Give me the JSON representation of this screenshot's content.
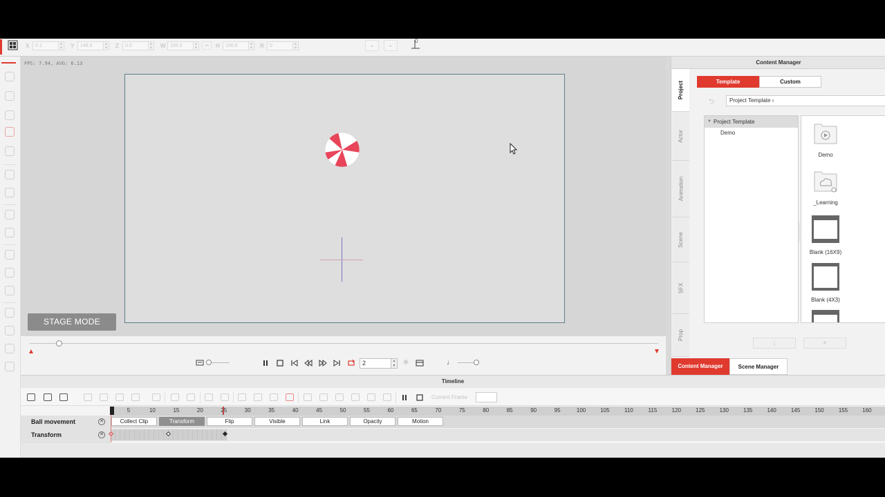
{
  "transform": {
    "fields": [
      {
        "label": "X",
        "value": "0.1"
      },
      {
        "label": "Y",
        "value": "149.9"
      },
      {
        "label": "Z",
        "value": "0.0"
      },
      {
        "label": "W",
        "value": "100.0"
      },
      {
        "label": "H",
        "value": "100.0"
      },
      {
        "label": "R",
        "value": "0"
      }
    ],
    "anchor_value": "0"
  },
  "stage": {
    "fps_text": "FPS: 7.94, AVG: 6.13",
    "mode_button": "STAGE MODE"
  },
  "playback": {
    "frame_value": "2"
  },
  "content_manager": {
    "title": "Content Manager",
    "vertical_tabs": [
      "Project",
      "Actor",
      "Animation",
      "Scene",
      "SFX",
      "Prop"
    ],
    "active_tab": "Project",
    "segment_tabs": [
      "Template",
      "Custom"
    ],
    "active_segment": "Template",
    "path": "Project Template",
    "tree_root": "Project Template",
    "tree_items": [
      "Demo"
    ],
    "thumbnails": [
      "Demo",
      "_Learning",
      "Blank (16X9)",
      "Blank (4X3)"
    ],
    "bottom_tabs": [
      "Content Manager",
      "Scene Manager"
    ],
    "active_bottom_tab": "Content Manager"
  },
  "timeline": {
    "title": "Timeline",
    "current_frame_label": "Current Frame",
    "ruler_ticks": [
      "5",
      "10",
      "15",
      "20",
      "25",
      "30",
      "35",
      "40",
      "45",
      "50",
      "55",
      "60",
      "65",
      "70",
      "75",
      "80",
      "85",
      "90",
      "95",
      "100",
      "105",
      "110",
      "115",
      "120",
      "125",
      "130",
      "135",
      "140",
      "145",
      "150",
      "155",
      "160"
    ],
    "tracks": [
      {
        "name": "Ball movement"
      },
      {
        "name": "Transform"
      }
    ],
    "chips": [
      "Collect Clip",
      "Transform",
      "Flip",
      "Visible",
      "Link",
      "Opacity",
      "Motion"
    ],
    "selected_chip": "Transform"
  },
  "colors": {
    "accent": "#e03a2f",
    "ball_red": "#e8455a"
  }
}
